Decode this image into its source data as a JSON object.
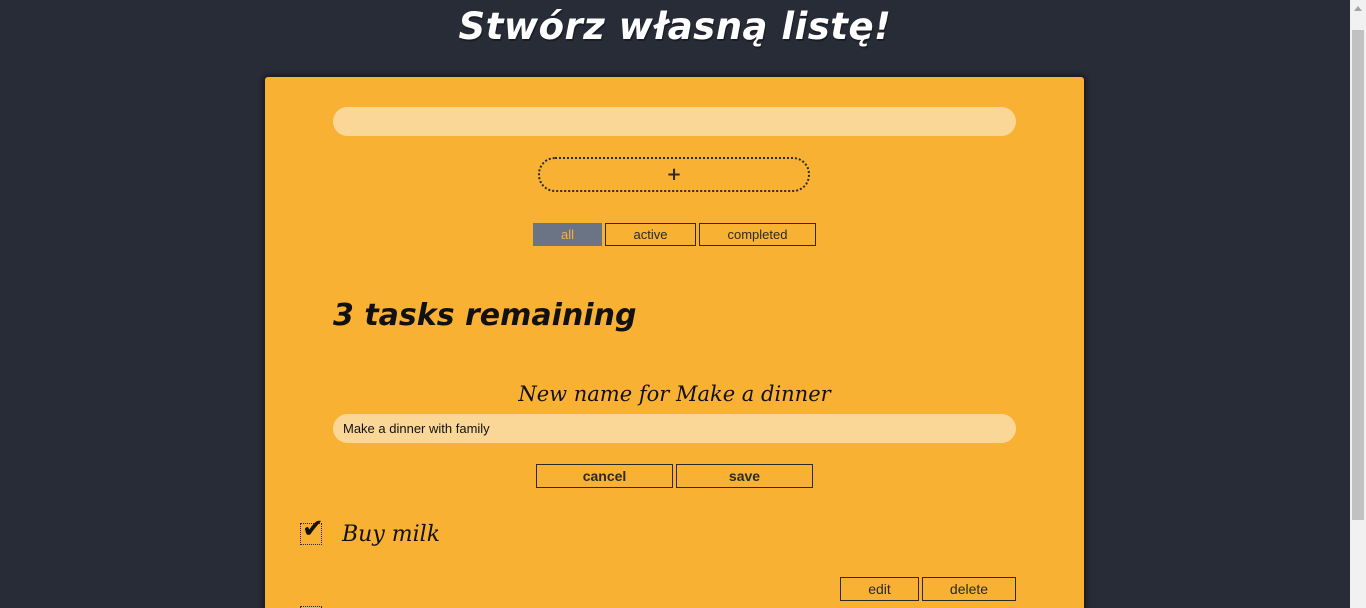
{
  "header": {
    "title": "Stwórz własną listę!"
  },
  "form": {
    "new_task_value": "",
    "add_label": "+"
  },
  "filters": [
    {
      "label": "all",
      "pressed": true
    },
    {
      "label": "active",
      "pressed": false
    },
    {
      "label": "completed",
      "pressed": false
    }
  ],
  "status": {
    "remaining": "3 tasks remaining"
  },
  "edit_form": {
    "label": "New name for Make a dinner",
    "value": "Make a dinner with family",
    "cancel_label": "cancel",
    "save_label": "save"
  },
  "tasks": [
    {
      "name": "Buy milk",
      "completed": true,
      "edit_label": "edit",
      "delete_label": "delete"
    }
  ],
  "colors": {
    "background": "#282c37",
    "card": "#f8b133",
    "input": "#fbd797",
    "selected_filter": "#6b7485"
  },
  "icons": {
    "checkmark": "check-icon",
    "add": "plus-icon"
  }
}
